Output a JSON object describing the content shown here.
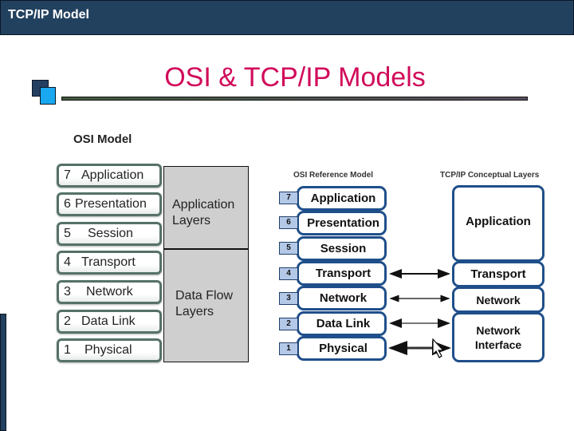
{
  "header": {
    "title": "TCP/IP Model"
  },
  "slide": {
    "title": "OSI & TCP/IP Models"
  },
  "osi_model": {
    "heading": "OSI Model",
    "layers": [
      {
        "num": "7",
        "name": "Application"
      },
      {
        "num": "6",
        "name": "Presentation"
      },
      {
        "num": "5",
        "name": "Session"
      },
      {
        "num": "4",
        "name": "Transport"
      },
      {
        "num": "3",
        "name": "Network"
      },
      {
        "num": "2",
        "name": "Data Link"
      },
      {
        "num": "1",
        "name": "Physical"
      }
    ],
    "groups": [
      {
        "label": "Application\nLayers",
        "covers": [
          "7",
          "6",
          "5"
        ]
      },
      {
        "label": "Data Flow\nLayers",
        "covers": [
          "4",
          "3",
          "2",
          "1"
        ]
      }
    ]
  },
  "comparison": {
    "osi_heading": "OSI Reference Model",
    "tcpip_heading": "TCP/IP Conceptual Layers",
    "osi_layers": [
      {
        "num": "7",
        "name": "Application"
      },
      {
        "num": "6",
        "name": "Presentation"
      },
      {
        "num": "5",
        "name": "Session"
      },
      {
        "num": "4",
        "name": "Transport"
      },
      {
        "num": "3",
        "name": "Network"
      },
      {
        "num": "2",
        "name": "Data Link"
      },
      {
        "num": "1",
        "name": "Physical"
      }
    ],
    "tcpip_layers": [
      {
        "name": "Application",
        "maps_to": [
          "7",
          "6",
          "5"
        ]
      },
      {
        "name": "Transport",
        "maps_to": [
          "4"
        ]
      },
      {
        "name": "Network",
        "maps_to": [
          "3"
        ]
      },
      {
        "name": "Network\nInterface",
        "maps_to": [
          "2",
          "1"
        ]
      }
    ]
  },
  "colors": {
    "header_bg": "#22415f",
    "title": "#d10a5a",
    "box_border": "#1f4f8a",
    "layer_number_bg": "#b4c8e8",
    "group_bg": "#cfcfcf"
  }
}
